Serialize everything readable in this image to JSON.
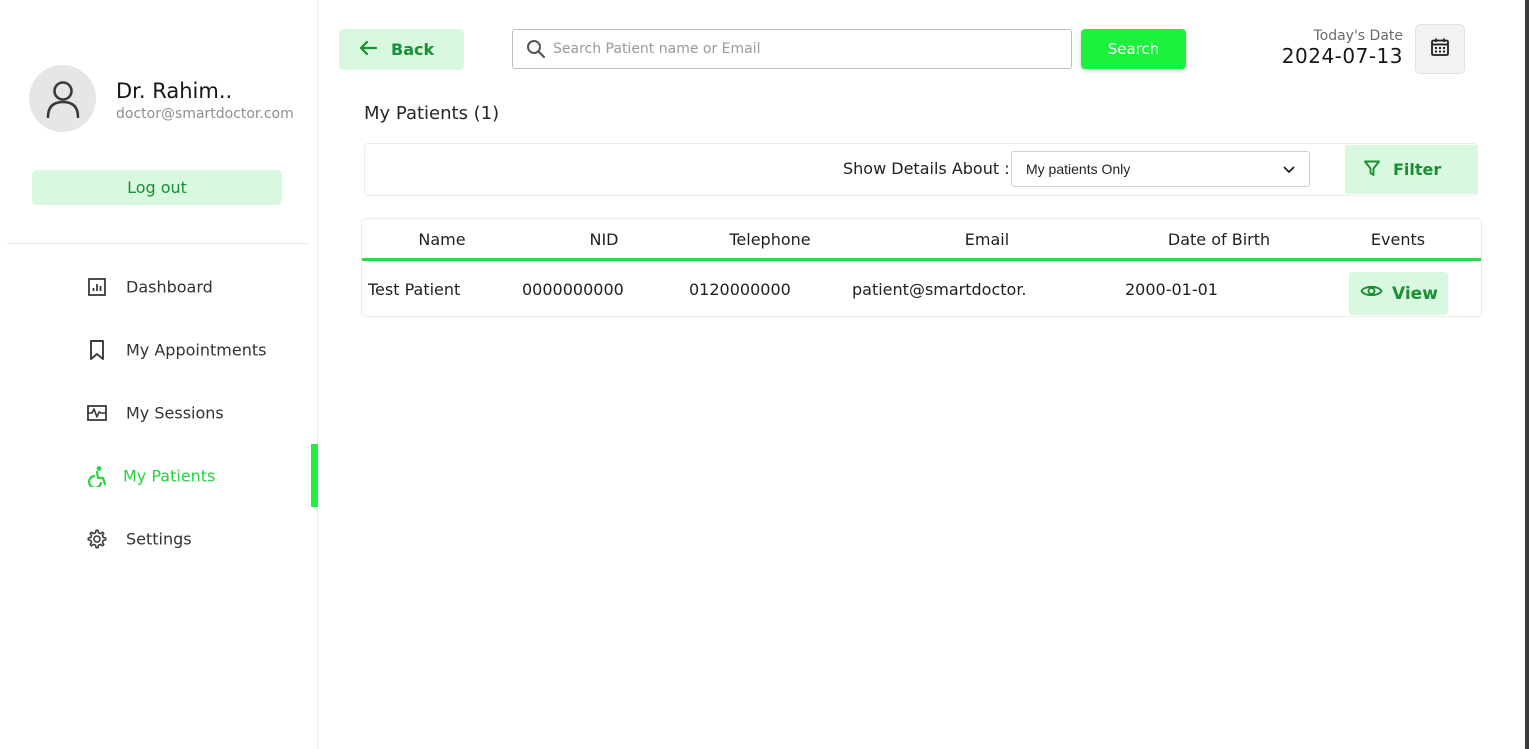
{
  "sidebar": {
    "profile": {
      "name": "Dr. Rahim..",
      "email": "doctor@smartdoctor.com",
      "avatar_icon": "user-avatar-icon"
    },
    "logout_label": "Log out",
    "nav": [
      {
        "label": "Dashboard",
        "icon": "dashboard-icon",
        "active": false
      },
      {
        "label": "My Appointments",
        "icon": "bookmark-icon",
        "active": false
      },
      {
        "label": "My Sessions",
        "icon": "sessions-icon",
        "active": false
      },
      {
        "label": "My Patients",
        "icon": "accessibility-icon",
        "active": true
      },
      {
        "label": "Settings",
        "icon": "gear-icon",
        "active": false
      }
    ]
  },
  "header": {
    "back_label": "Back",
    "search": {
      "placeholder": "Search Patient name or Email",
      "value": "",
      "button_label": "Search"
    },
    "date": {
      "caption": "Today's Date",
      "value": "2024-07-13"
    }
  },
  "main": {
    "title": "My Patients (1)",
    "filter": {
      "label": "Show Details About :",
      "selected": "My patients Only",
      "button_label": "Filter"
    },
    "table": {
      "columns": [
        "Name",
        "NID",
        "Telephone",
        "Email",
        "Date of Birth",
        "Events"
      ],
      "rows": [
        {
          "name": "Test Patient",
          "nid": "0000000000",
          "telephone": "0120000000",
          "email": "patient@smartdoctor.",
          "dob": "2000-01-01",
          "action_label": "View"
        }
      ]
    }
  },
  "colors": {
    "accent": "#1cf23d",
    "accent_soft": "#d8f9df",
    "accent_text": "#1a8f33",
    "active_nav_text": "#25d33f"
  }
}
